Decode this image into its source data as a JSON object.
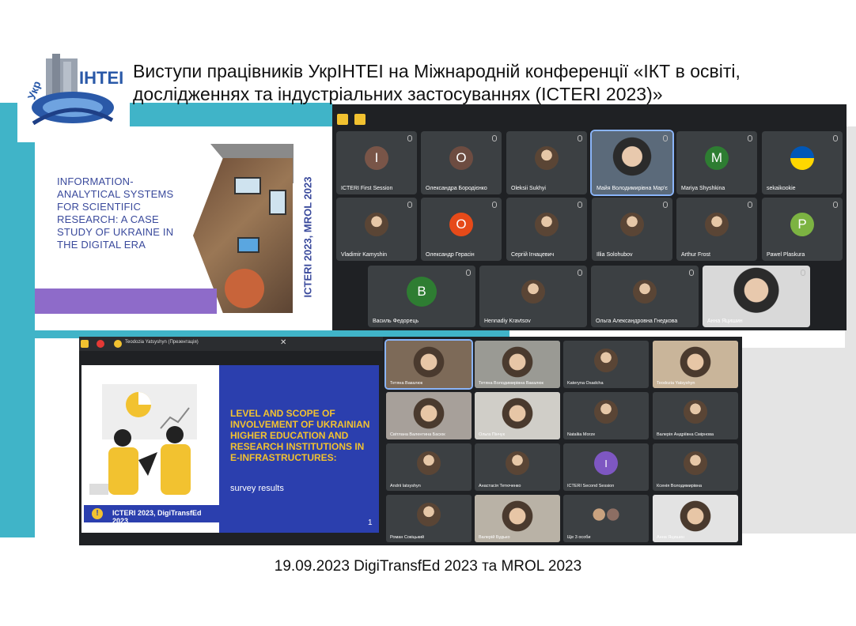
{
  "title": "Виступи працівників УкрІНТЕІ на Міжнародній конференції «ІКТ в освіті, дослідженнях та індустріальних застосуваннях (ICTERI 2023)»",
  "footer": "19.09.2023  DigiTransfEd 2023 та MROL 2023",
  "logo": {
    "text": "ІНТЕІ",
    "prefix": "Укр"
  },
  "slide1": {
    "heading": "INFORMATION-ANALYTICAL SYSTEMS FOR SCIENTIFIC RESEARCH: A CASE STUDY OF UKRAINE IN THE DIGITAL ERA",
    "vertical": "ICTERI 2023, MROL 2023"
  },
  "meeting1": {
    "participants": [
      {
        "name": "ICTERI First Session",
        "initial": "I",
        "color": "#795548"
      },
      {
        "name": "Олександра Бородієнко",
        "initial": "О",
        "color": "#6d4c41"
      },
      {
        "name": "Oleksii Sukhyi",
        "initial": "",
        "color": ""
      },
      {
        "name": "Майя Володимирівна Мар'є",
        "initial": "",
        "color": ""
      },
      {
        "name": "Mariya Shyshkina",
        "initial": "M",
        "color": "#2e7d32"
      },
      {
        "name": "sekaikookie",
        "initial": "",
        "color": ""
      },
      {
        "name": "Vladimir Kamyshin",
        "initial": "",
        "color": ""
      },
      {
        "name": "Олександр Герасін",
        "initial": "О",
        "color": "#e64a19"
      },
      {
        "name": "Сергій Ігнацевич",
        "initial": "",
        "color": ""
      },
      {
        "name": "Illia Solohubov",
        "initial": "",
        "color": ""
      },
      {
        "name": "Arthur Frost",
        "initial": "",
        "color": ""
      },
      {
        "name": "Pawel Plaskura",
        "initial": "P",
        "color": "#7cb342"
      },
      {
        "name": "Василь Федорець",
        "initial": "В",
        "color": "#2e7d32"
      },
      {
        "name": "Hennadiy Kravtsov",
        "initial": "",
        "color": ""
      },
      {
        "name": "Ольга Александровна Гнедкова",
        "initial": "",
        "color": ""
      },
      {
        "name": "Анна Яцишин",
        "initial": "",
        "color": ""
      }
    ]
  },
  "meeting2": {
    "presenter_bar": "Teodozia Yatsyshyn (Презентація)",
    "slide": {
      "heading": "LEVEL AND SCOPE OF INVOLVEMENT OF UKRAINIAN HIGHER EDUCATION AND RESEARCH INSTITUTIONS IN E-INFRASTRUCTURES:",
      "subtitle": "survey results",
      "badge": "ICTERI 2023, DigiTransfEd 2023",
      "page": "1"
    },
    "participants": [
      {
        "name": "Тетяна Вакалюк",
        "initial": ""
      },
      {
        "name": "Тетяна Володимирівна Вакалюк",
        "initial": ""
      },
      {
        "name": "Kateryna Osadcha",
        "initial": ""
      },
      {
        "name": "Teodozia Yatsyshyn",
        "initial": ""
      },
      {
        "name": "Світлана Валентина Басюк",
        "initial": ""
      },
      {
        "name": "Ольга Пінчук",
        "initial": ""
      },
      {
        "name": "Nataliia Morze",
        "initial": ""
      },
      {
        "name": "Валерія Андріївна Смірнова",
        "initial": ""
      },
      {
        "name": "Andrii Iatsyshyn",
        "initial": ""
      },
      {
        "name": "Анастасія Тетюченко",
        "initial": ""
      },
      {
        "name": "ICTERI Second Session",
        "initial": "I"
      },
      {
        "name": "Ксенія Володимирівна",
        "initial": ""
      },
      {
        "name": "Роман Сокіцький",
        "initial": ""
      },
      {
        "name": "Валерій Будько",
        "initial": ""
      },
      {
        "name": "Ще 3 особи",
        "initial": ""
      },
      {
        "name": "Анна Яцишин",
        "initial": ""
      }
    ]
  }
}
